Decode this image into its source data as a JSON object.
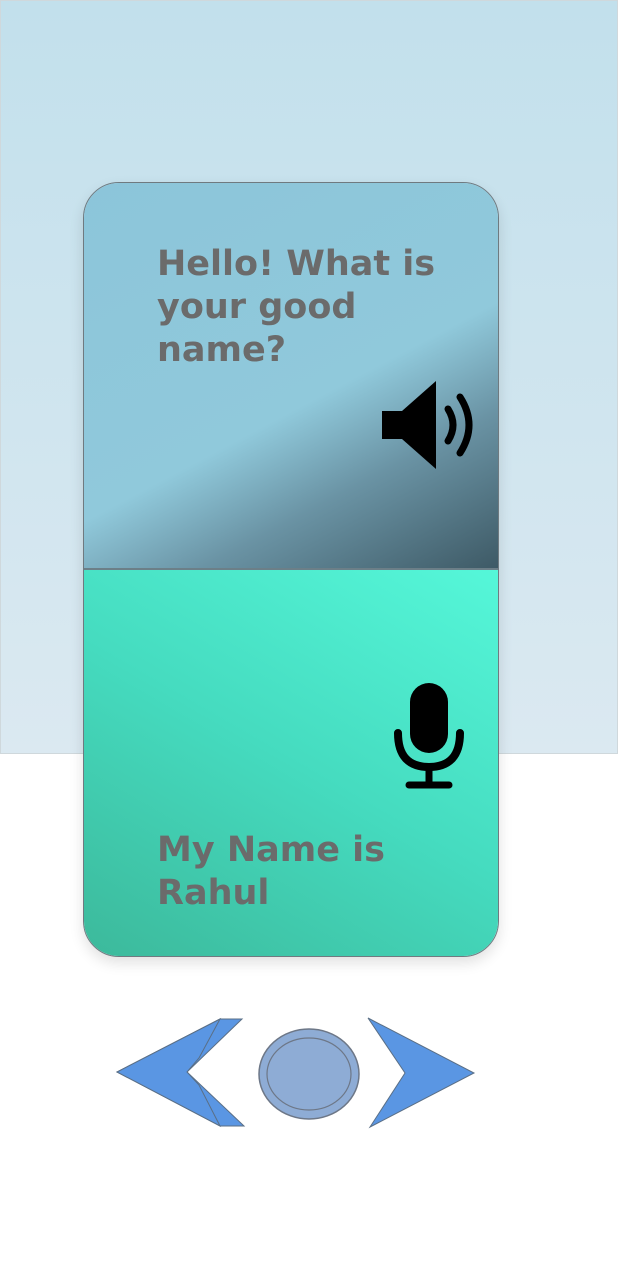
{
  "conversation": {
    "question": "Hello! What is your good name?",
    "answer": "My Name is Rahul"
  },
  "icons": {
    "speaker": "speaker-volume-icon",
    "microphone": "microphone-icon",
    "back": "back-arrow-icon",
    "home": "home-button-icon",
    "forward": "forward-arrow-icon"
  },
  "colors": {
    "question_panel": "#8fc8da",
    "answer_panel": "#48dfc2",
    "nav_buttons": "#5a96e3",
    "home_button": "#8eacd5",
    "text": "#6b6b6b"
  }
}
